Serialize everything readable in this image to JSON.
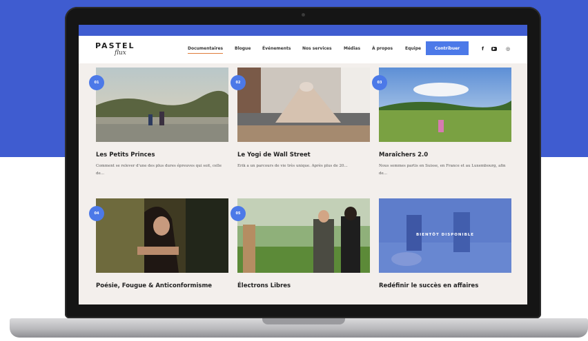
{
  "site": {
    "logo_text": "PASTEL",
    "logo_script": "flux",
    "nav": [
      {
        "label": "Documentaires",
        "active": true
      },
      {
        "label": "Blogue"
      },
      {
        "label": "Événements"
      },
      {
        "label": "Nos services"
      },
      {
        "label": "Médias"
      },
      {
        "label": "À propos"
      },
      {
        "label": "Equipe"
      }
    ],
    "cta_label": "Contribuer",
    "social": {
      "facebook": "f",
      "youtube": "▶",
      "instagram": "◎"
    }
  },
  "cards": [
    {
      "num": "01",
      "title": "Les Petits Princes",
      "desc": "Comment se relever d'une des plus dures épreuves qui soit, celle de..."
    },
    {
      "num": "02",
      "title": "Le Yogi de Wall Street",
      "desc": "Erik a un parcours de vie très unique. Après plus de 20..."
    },
    {
      "num": "03",
      "title": "Maraîchers 2.0",
      "desc": "Nous sommes partis en Suisse, en France et au Luxembourg, afin de..."
    },
    {
      "num": "04",
      "title": "Poésie, Fougue & Anticonformisme",
      "desc": ""
    },
    {
      "num": "05",
      "title": "Électrons Libres",
      "desc": ""
    },
    {
      "num": "",
      "title": "Redéfinir le succès en affaires",
      "desc": "",
      "overlay": "BIENTÔT DISPONIBLE"
    }
  ],
  "colors": {
    "brand_blue": "#3f5cd0",
    "accent_blue": "#4c79e8",
    "nav_underline": "#e07b39"
  }
}
